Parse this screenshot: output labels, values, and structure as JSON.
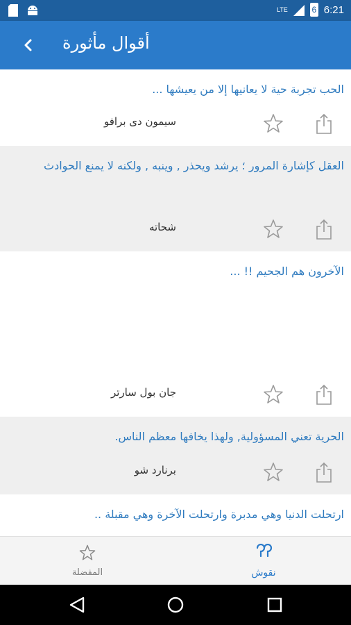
{
  "status": {
    "time": "6:21",
    "network": "LTE",
    "battery_level": "6"
  },
  "appbar": {
    "title": "أقوال مأثورة"
  },
  "quotes": [
    {
      "text": "الحب تجربة حية لا يعانيها إلا من يعيشها ...",
      "author": "سيمون دى برافو"
    },
    {
      "text": "العقل كإشارة المرور ؛ يرشد ويحذر , وينبه , ولكنه لا يمنع الحوادث",
      "author": "شحاته"
    },
    {
      "text": "الآخرون هم الجحيم !! ...",
      "author": "جان بول سارتر"
    },
    {
      "text": "الحرية تعني المسؤولية, ولهذا يخافها معظم الناس.",
      "author": "برنارد شو"
    },
    {
      "text": "ارتحلت الدنيا وهي مدبرة وارتحلت الآخرة وهي مقبلة ..",
      "author": ""
    }
  ],
  "bottom_nav": {
    "favorites_label": "المفضلة",
    "quotes_label": "نقوش"
  },
  "colors": {
    "accent": "#2b7bca",
    "quote_text": "#2f7bbf",
    "status_bar": "#1e5f9e"
  }
}
